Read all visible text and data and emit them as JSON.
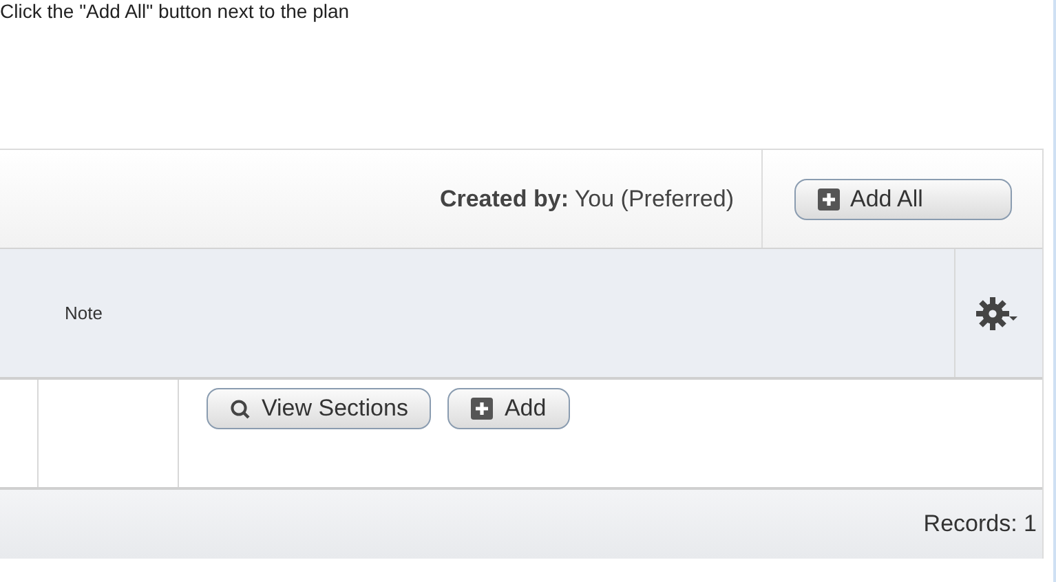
{
  "instruction": "Click the \"Add All\" button next to the plan",
  "header": {
    "created_by": "**Created by:** You (Preferred)",
    "add_all_button": "Add All"
  },
  "table": {
    "columns": [
      {
        "label": "Note"
      }
    ],
    "rows": [
      {
        "buttons": [
          {
            "kind": "search",
            "label": "View Sections"
          },
          {
            "kind": "add",
            "label": "Add"
          }
        ]
      }
    ]
  },
  "footer": {
    "records": "Records: 1"
  }
}
